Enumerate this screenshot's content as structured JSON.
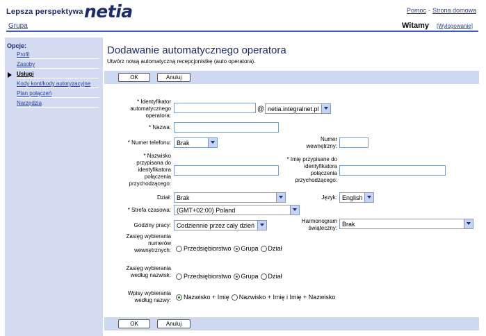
{
  "header": {
    "tagline": "Lepsza perspektywa",
    "logo": "netia",
    "nav_group": "Grupa",
    "help_link": "Pomoc",
    "separator": "-",
    "home_link": "Strona domowa",
    "welcome": "Witamy",
    "logout": "[Wylogowanie]"
  },
  "sidebar": {
    "title": "Opcje:",
    "items": [
      {
        "label": "Profil"
      },
      {
        "label": "Zasoby"
      },
      {
        "label": "Usługi"
      },
      {
        "label": "Kody kont/kody autoryzacyjne"
      },
      {
        "label": "Plan połączeń"
      },
      {
        "label": "Narzędzia"
      }
    ]
  },
  "main": {
    "title": "Dodawanie automatycznego operatora",
    "subtitle": "Utwórz nową automatyczną recepcjonistkę (auto operatora).",
    "ok_label": "OK",
    "cancel_label": "Anuluj"
  },
  "form": {
    "operator_id_label": "* Identyfikator automatycznego operatora:",
    "operator_id_value": "",
    "at_sign": "@",
    "domain_value": "netia.integralnet.pl",
    "name_label": "* Nazwa:",
    "name_value": "",
    "phone_label": "* Numer telefonu:",
    "phone_value": "Brak",
    "extension_label": "Numer wewnętrzny:",
    "extension_value": "",
    "caller_last_label": "* Nazwisko przypisana do identyfikatora połączenia przychodzącego:",
    "caller_last_value": "",
    "caller_first_label": "* Imię przypisane do identyfikatora połączenia przychodzącego:",
    "caller_first_value": "",
    "department_label": "Dział:",
    "department_value": "Brak",
    "language_label": "Język:",
    "language_value": "English",
    "timezone_label": "* Strefa czasowa:",
    "timezone_value": "(GMT+02:00) Poland",
    "hours_label": "Godziny pracy:",
    "hours_value": "Codziennie przez cały dzień",
    "holiday_label": "Harmonogram świąteczny:",
    "holiday_value": "Brak",
    "ext_scope_label": "Zasięg wybierania numerów wewnętrznych:",
    "name_scope_label": "Zasięg wybierania według nazwisk:",
    "scope_options": [
      "Przedsiębiorstwo",
      "Grupa",
      "Dział"
    ],
    "scope_selected": "Grupa",
    "name_entries_label": "Wpisy wybierania według nazwy:",
    "name_entries_options": [
      "Nazwisko + Imię",
      "Nazwisko + Imię i Imię + Nazwisko"
    ],
    "name_entries_selected": "Nazwisko + Imię"
  },
  "colors": {
    "brand": "#1d2b6b",
    "link": "#2a3f8f",
    "sidebar_bg": "#d3dbf2",
    "button_bar_bg": "#cfd8f1"
  }
}
